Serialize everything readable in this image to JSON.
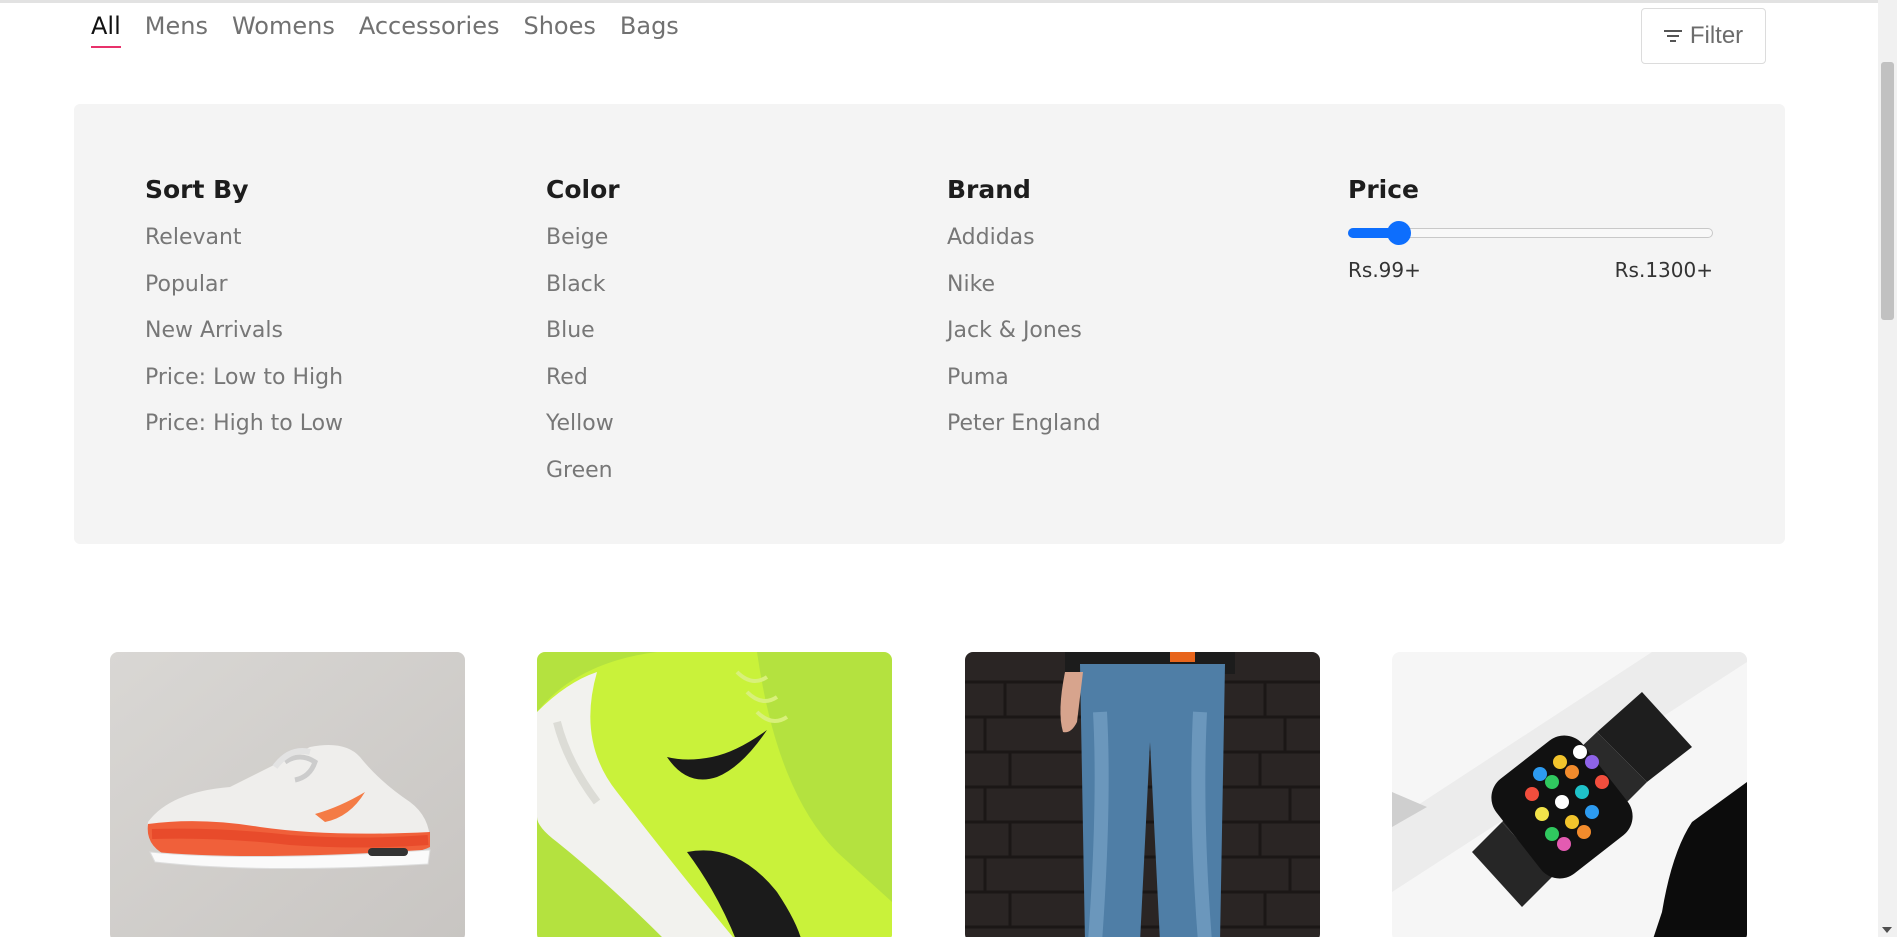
{
  "tabs": [
    {
      "label": "All",
      "active": true
    },
    {
      "label": "Mens",
      "active": false
    },
    {
      "label": "Womens",
      "active": false
    },
    {
      "label": "Accessories",
      "active": false
    },
    {
      "label": "Shoes",
      "active": false
    },
    {
      "label": "Bags",
      "active": false
    }
  ],
  "filter_button": {
    "label": "Filter",
    "icon": "filter-lines-icon"
  },
  "filters": {
    "sort": {
      "title": "Sort By",
      "options": [
        "Relevant",
        "Popular",
        "New Arrivals",
        "Price: Low to High",
        "Price: High to Low"
      ]
    },
    "color": {
      "title": "Color",
      "options": [
        "Beige",
        "Black",
        "Blue",
        "Red",
        "Yellow",
        "Green"
      ]
    },
    "brand": {
      "title": "Brand",
      "options": [
        "Addidas",
        "Nike",
        "Jack & Jones",
        "Puma",
        "Peter England"
      ]
    },
    "price": {
      "title": "Price",
      "min_label": "Rs.99+",
      "max_label": "Rs.1300+",
      "slider_fraction": 0.14
    }
  },
  "products": [
    {
      "image": "orange-white-sneaker"
    },
    {
      "image": "neon-green-sneaker"
    },
    {
      "image": "blue-jeans-brick-wall"
    },
    {
      "image": "smartwatch-black-band"
    }
  ],
  "colors": {
    "accent_underline": "#e8316b",
    "slider": "#0d6efd",
    "panel_bg": "#f4f4f4"
  }
}
